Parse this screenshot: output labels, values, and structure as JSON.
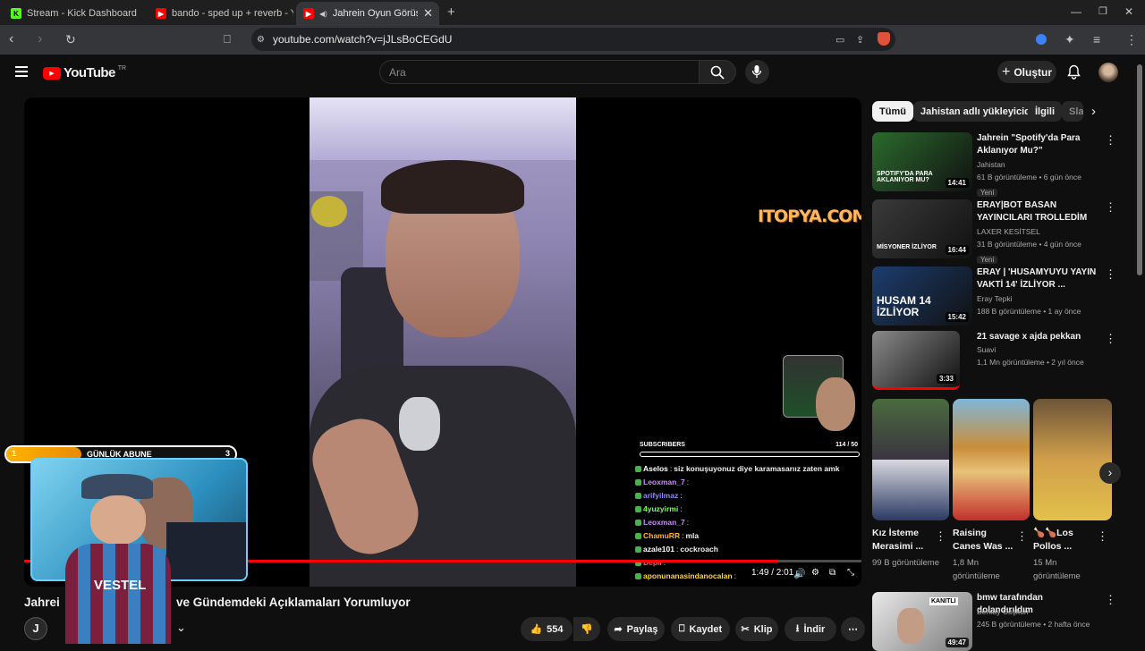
{
  "browser": {
    "tabs": [
      {
        "title": "Stream - Kick Dashboard",
        "icon": "kick-icon"
      },
      {
        "title": "bando - sped up + reverb - YouTube",
        "icon": "youtube-icon"
      },
      {
        "title": "Jahrein Oyun Görüşmelerin",
        "icon": "youtube-icon",
        "active": true
      }
    ],
    "url": "youtube.com/watch?v=jJLsBoCEGdU"
  },
  "youtube": {
    "logo": "YouTube",
    "country": "TR",
    "search_placeholder": "Ara",
    "create_label": "Oluştur"
  },
  "player": {
    "watermark": "ITOPYA.COM",
    "subscribers_label": "SUBSCRIBERS",
    "subscribers_count": "114 / 50",
    "time": "1:49 / 2:01",
    "progress": 0.9,
    "daily_label": "GÜNLÜK ABUNE",
    "daily_left": "1",
    "daily_right": "3",
    "daily_progress": 0.33,
    "chat": [
      {
        "user": "Aselos",
        "msg": "siz konuşuyonuz diye karamasarıız zaten amk",
        "color": "#ffffff"
      },
      {
        "user": "Leoxman_7",
        "msg": "",
        "color": "#ce8cff"
      },
      {
        "user": "arifyilmaz",
        "msg": "",
        "color": "#8e8cff"
      },
      {
        "user": "4yuzyirmi",
        "msg": "",
        "color": "#7cff5a"
      },
      {
        "user": "Leoxman_7",
        "msg": "",
        "color": "#ce8cff"
      },
      {
        "user": "ChamuRR",
        "msg": "mla",
        "color": "#ffb347"
      },
      {
        "user": "azale101",
        "msg": "cockroach",
        "color": "#ffffff"
      },
      {
        "user": "Depii",
        "msg": "",
        "color": "#ff5a5a"
      },
      {
        "user": "aponunanasindanocalan",
        "msg": "",
        "color": "#ffd24d"
      }
    ]
  },
  "video": {
    "title_start": "Jahrei",
    "title_end": "ve Gündemdeki Açıklamaları Yorumluyor",
    "likes": "554",
    "share": "Paylaş",
    "save": "Kaydet",
    "clip": "Klip",
    "download": "İndir"
  },
  "chips": [
    "Tümü",
    "Jahistan adlı yükleyiciden",
    "İlgili",
    "Sla"
  ],
  "recommendations": [
    {
      "title": "Jahrein \"Spotify'da Para Aklanıyor Mu?\"",
      "channel": "Jahistan",
      "meta": "61 B görüntüleme • 6 gün önce",
      "badge": "Yeni",
      "duration": "14:41",
      "thumb_text": "SPOTIFY'DA PARA AKLANIYOR MU?",
      "thumb_color": "#2b6a2e"
    },
    {
      "title": "ERAY|BOT BASAN YAYINCILARI TROLLEDİM İZLİYOR ...",
      "channel": "LAXER KESİTSEL",
      "meta": "31 B görüntüleme • 4 gün önce",
      "badge": "Yeni",
      "duration": "16:44",
      "thumb_text": "MİSYONER İZLİYOR",
      "thumb_color": "#3a3a3a"
    },
    {
      "title": "ERAY | 'HUSAMYUYU YAYIN VAKTİ 14' İZLİYOR ...",
      "channel": "Eray Tepki",
      "meta": "188 B görüntüleme • 1 ay önce",
      "badge": "",
      "duration": "15:42",
      "thumb_text": "HUSAM 14 İZLİYOR",
      "thumb_color": "#1c3d6e"
    },
    {
      "title": "21 savage x ajda pekkan",
      "channel": "Suavi",
      "meta": "1,1 Mn görüntüleme • 2 yıl önce",
      "badge": "",
      "duration": "3:33",
      "thumb_text": "",
      "thumb_color": "#8a8a8a"
    }
  ],
  "shorts": [
    {
      "title": "Kız İsteme Merasimi ...",
      "views": "99 B görüntüleme"
    },
    {
      "title": "Raising Canes Was ...",
      "views": "1,8 Mn görüntüleme"
    },
    {
      "title": "🍗🍗Los Pollos ...",
      "views": "15 Mn görüntüleme"
    }
  ],
  "last_rec": {
    "title": "bmw tarafından dolandırıldım",
    "channel": "Berkay Coşkun",
    "meta": "245 B görüntüleme • 2 hafta önce",
    "duration": "49:47",
    "thumb_text": "KANITLI"
  }
}
